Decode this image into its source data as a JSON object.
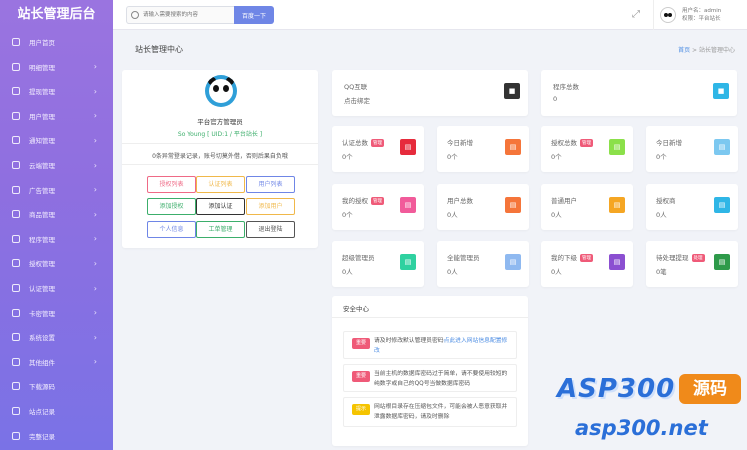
{
  "sidebar": {
    "brand": "站长管理后台",
    "items": [
      {
        "label": "用户首页",
        "icon": "home-icon",
        "arrow": false
      },
      {
        "label": "明细管理",
        "icon": "list-icon",
        "arrow": true
      },
      {
        "label": "提现管理",
        "icon": "wallet-icon",
        "arrow": true
      },
      {
        "label": "用户管理",
        "icon": "user-icon",
        "arrow": true
      },
      {
        "label": "通知管理",
        "icon": "bell-icon",
        "arrow": true
      },
      {
        "label": "云端管理",
        "icon": "cloud-icon",
        "arrow": true
      },
      {
        "label": "广告管理",
        "icon": "ad-icon",
        "arrow": true
      },
      {
        "label": "商品管理",
        "icon": "box-icon",
        "arrow": true
      },
      {
        "label": "程序管理",
        "icon": "code-icon",
        "arrow": true
      },
      {
        "label": "授权管理",
        "icon": "flag-icon",
        "arrow": true
      },
      {
        "label": "认证管理",
        "icon": "shield-icon",
        "arrow": true
      },
      {
        "label": "卡密管理",
        "icon": "card-icon",
        "arrow": true
      },
      {
        "label": "系统设置",
        "icon": "gear-icon",
        "arrow": true
      },
      {
        "label": "其他组件",
        "icon": "component-icon",
        "arrow": true
      },
      {
        "label": "下载源码",
        "icon": "download-icon",
        "arrow": false
      },
      {
        "label": "站点记录",
        "icon": "globe-icon",
        "arrow": false
      },
      {
        "label": "完整记录",
        "icon": "record-icon",
        "arrow": false
      }
    ]
  },
  "topbar": {
    "search_placeholder": "请输入需要搜索的内容",
    "search_button": "百度一下",
    "fullscreen_icon": "fullscreen-icon",
    "username_line": "用户名：admin",
    "role_line": "权限：平台站长"
  },
  "page": {
    "title": "站长管理中心",
    "breadcrumb_home": "首页",
    "breadcrumb_sep": ">",
    "breadcrumb_current": "站长管理中心"
  },
  "profile": {
    "role": "平台官方管理员",
    "meta": "So Young [ UID:1 / 平台站长 ]",
    "notice": "0条异常登录记录，账号切莫外借，否则后果自负哦",
    "buttons": [
      {
        "label": "授权列表",
        "color": "#ef6a86",
        "icon": "list-icon"
      },
      {
        "label": "认证列表",
        "color": "#f0b84a",
        "icon": "list-icon"
      },
      {
        "label": "用户列表",
        "color": "#6f86e6",
        "icon": "list-icon"
      },
      {
        "label": "添加授权",
        "color": "#3cae6b",
        "icon": "add-icon"
      },
      {
        "label": "添加认证",
        "color": "#333333",
        "icon": "add-icon"
      },
      {
        "label": "添加用户",
        "color": "#f0b84a",
        "icon": "user-add-icon"
      },
      {
        "label": "个人信息",
        "color": "#6f86e6",
        "icon": "user-icon"
      },
      {
        "label": "工单管理",
        "color": "#3cae6b",
        "icon": "ticket-icon"
      },
      {
        "label": "退出登陆",
        "color": "#555555",
        "icon": "power-icon"
      }
    ]
  },
  "wide_cards": [
    {
      "label": "QQ互联",
      "value": "点击绑定",
      "color": "#333333",
      "icon": "qq-icon"
    },
    {
      "label": "程序总数",
      "value": "0",
      "color": "#2fb6e6",
      "icon": "app-icon"
    }
  ],
  "stats": [
    {
      "label": "认证总数",
      "tag": "管理",
      "value": "0个",
      "color": "#e62b3c",
      "icon": "doc-icon"
    },
    {
      "label": "今日新增",
      "tag": "",
      "value": "0个",
      "color": "#f5753a",
      "icon": "doc-icon"
    },
    {
      "label": "授权总数",
      "tag": "管理",
      "value": "0个",
      "color": "#8be04a",
      "icon": "doc-icon"
    },
    {
      "label": "今日新增",
      "tag": "",
      "value": "0个",
      "color": "#7cc8f0",
      "icon": "doc-icon"
    },
    {
      "label": "我的授权",
      "tag": "管理",
      "value": "0个",
      "color": "#f15b9a",
      "icon": "doc-icon"
    },
    {
      "label": "用户总数",
      "tag": "",
      "value": "0人",
      "color": "#f5753a",
      "icon": "doc-icon"
    },
    {
      "label": "普通用户",
      "tag": "",
      "value": "0人",
      "color": "#f5a623",
      "icon": "doc-icon"
    },
    {
      "label": "授权商",
      "tag": "",
      "value": "0人",
      "color": "#2fb6e6",
      "icon": "doc-icon"
    },
    {
      "label": "超级管理员",
      "tag": "",
      "value": "0人",
      "color": "#2fd1a0",
      "icon": "doc-icon"
    },
    {
      "label": "全能管理员",
      "tag": "",
      "value": "0人",
      "color": "#8fb9f0",
      "icon": "doc-icon"
    },
    {
      "label": "我的下级",
      "tag": "管理",
      "value": "0人",
      "color": "#8b4fd1",
      "icon": "user-icon"
    },
    {
      "label": "待处理提现",
      "tag": "处理",
      "value": "0笔",
      "color": "#2e9a4a",
      "icon": "download-icon"
    }
  ],
  "security": {
    "title": "安全中心",
    "items": [
      {
        "badge": "重要",
        "badge_color": "#ef5a78",
        "text": "请及时修改默认管理员密码",
        "link": "点此进入网站信息配置修改"
      },
      {
        "badge": "重要",
        "badge_color": "#ef5a78",
        "text": "当前主机的数据库密码过于简单，请不要使用较短的纯数字或自己的QQ号当做数据库密码",
        "link": ""
      },
      {
        "badge": "提示",
        "badge_color": "#f5c400",
        "text": "网站根目录存在压缩包文件，可能会被人恶意获取并泄露数据库密码，请及时删除",
        "link": ""
      }
    ]
  },
  "watermark": {
    "line1": "ASP300",
    "badge": "源码",
    "line2": "asp300.net"
  }
}
